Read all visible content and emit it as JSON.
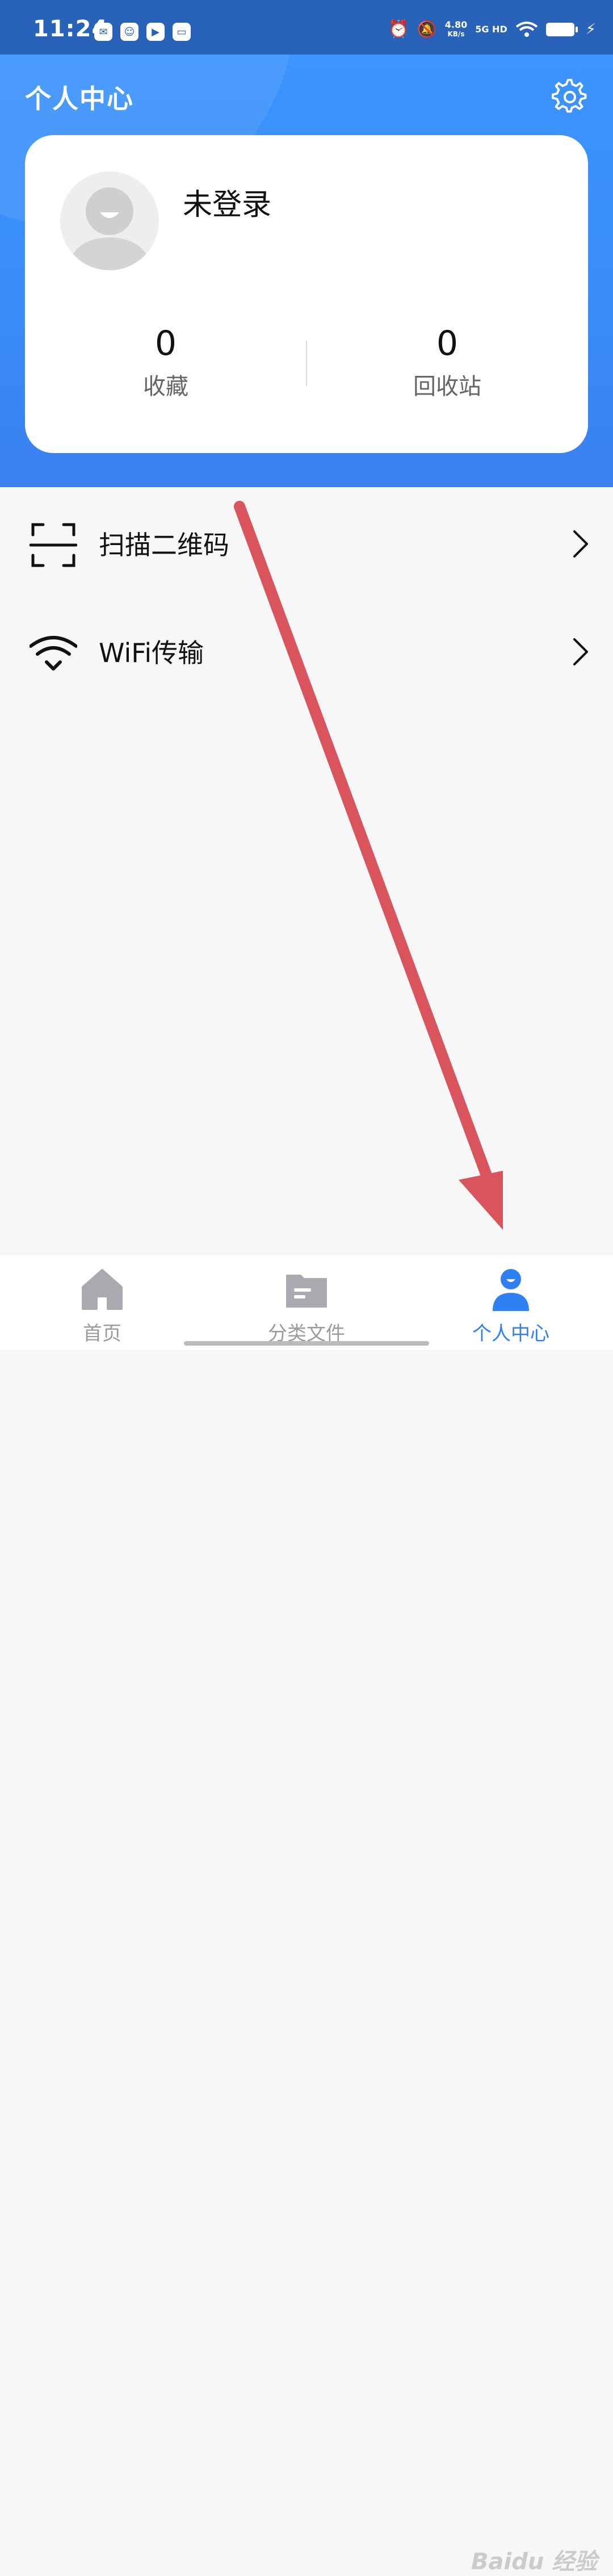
{
  "status_bar": {
    "time": "11:24",
    "apps": [
      "wechat-icon",
      "qq-icon",
      "play-icon",
      "mail-icon"
    ],
    "net_speed_value": "4.80",
    "net_speed_unit": "KB/s",
    "network": "5G HD"
  },
  "header": {
    "title": "个人中心",
    "settings_icon": "gear-icon"
  },
  "profile": {
    "login_status": "未登录",
    "stats": [
      {
        "value": "0",
        "label": "收藏"
      },
      {
        "value": "0",
        "label": "回收站"
      }
    ]
  },
  "menu": [
    {
      "icon": "scan-qr-icon",
      "label": "扫描二维码"
    },
    {
      "icon": "wifi-icon",
      "label": "WiFi传输"
    }
  ],
  "tabbar": [
    {
      "icon": "home-icon",
      "label": "首页"
    },
    {
      "icon": "folder-icon",
      "label": "分类文件"
    },
    {
      "icon": "person-icon",
      "label": "个人中心",
      "active": true
    }
  ],
  "colors": {
    "primary": "#3a8ef8",
    "status_bar": "#2862b9",
    "active_tab": "#2f80f5",
    "annotation_arrow": "#d9545c"
  },
  "watermark": "Baidu 经验"
}
